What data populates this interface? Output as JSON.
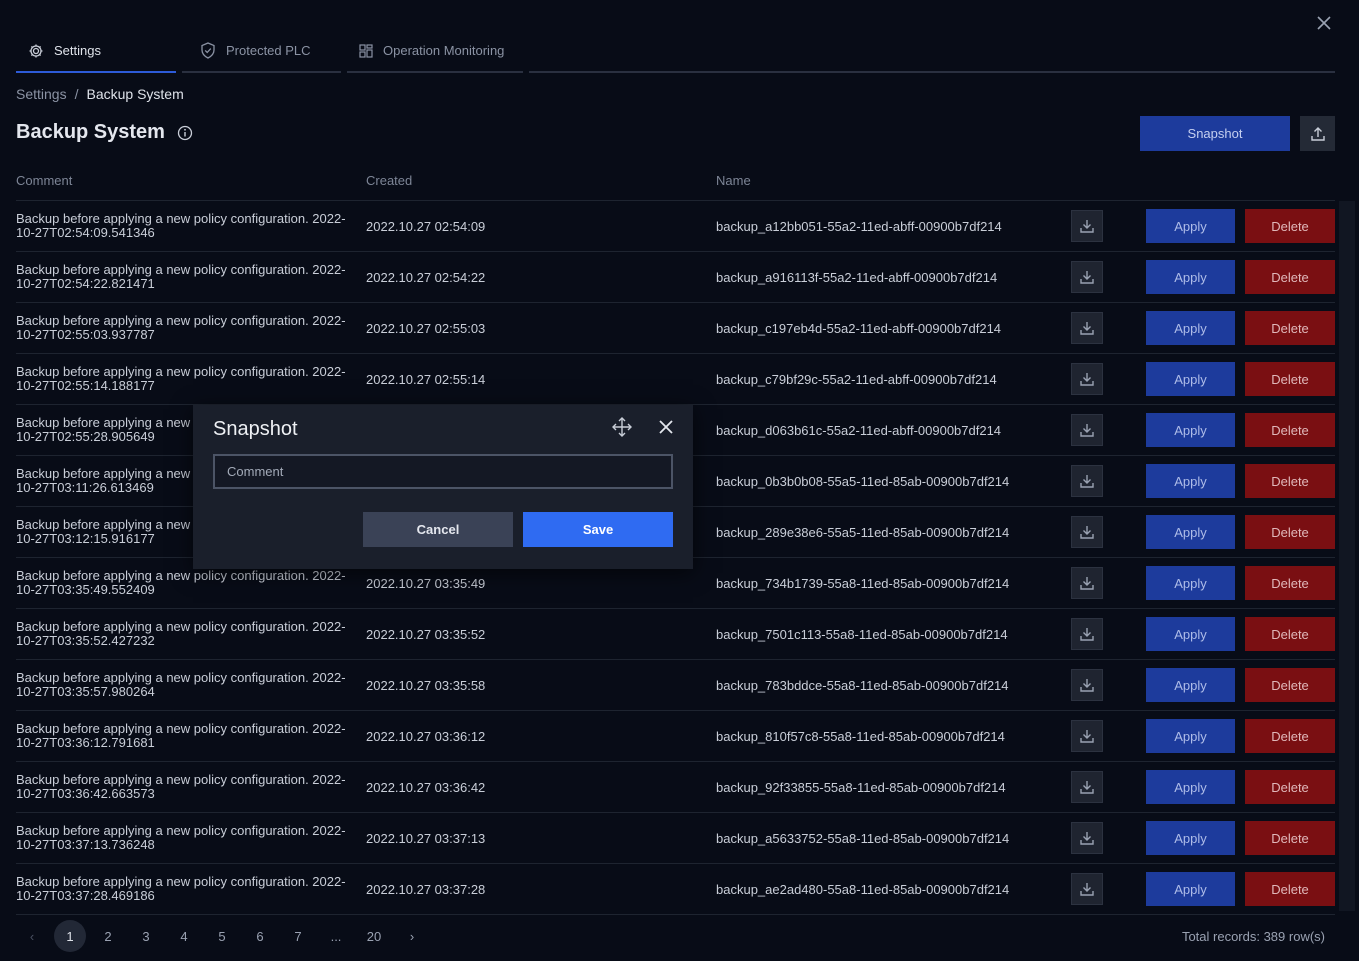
{
  "tabs": [
    {
      "label": "Settings",
      "icon": "gear-icon",
      "active": true
    },
    {
      "label": "Protected PLC",
      "icon": "shield-icon",
      "active": false
    },
    {
      "label": "Operation Monitoring",
      "icon": "grid-icon",
      "active": false
    }
  ],
  "breadcrumb": {
    "root": "Settings",
    "separator": "/",
    "current": "Backup System"
  },
  "page": {
    "title": "Backup System",
    "snapshot_label": "Snapshot"
  },
  "table": {
    "headers": {
      "comment": "Comment",
      "created": "Created",
      "name": "Name"
    },
    "apply_label": "Apply",
    "delete_label": "Delete",
    "rows": [
      {
        "comment": "Backup before applying a new policy configuration. 2022-10-27T02:54:09.541346",
        "created": "2022.10.27 02:54:09",
        "name": "backup_a12bb051-55a2-11ed-abff-00900b7df214"
      },
      {
        "comment": "Backup before applying a new policy configuration. 2022-10-27T02:54:22.821471",
        "created": "2022.10.27 02:54:22",
        "name": "backup_a916113f-55a2-11ed-abff-00900b7df214"
      },
      {
        "comment": "Backup before applying a new policy configuration. 2022-10-27T02:55:03.937787",
        "created": "2022.10.27 02:55:03",
        "name": "backup_c197eb4d-55a2-11ed-abff-00900b7df214"
      },
      {
        "comment": "Backup before applying a new policy configuration. 2022-10-27T02:55:14.188177",
        "created": "2022.10.27 02:55:14",
        "name": "backup_c79bf29c-55a2-11ed-abff-00900b7df214"
      },
      {
        "comment": "Backup before applying a new policy configuration. 2022-10-27T02:55:28.905649",
        "created": "",
        "name": "backup_d063b61c-55a2-11ed-abff-00900b7df214"
      },
      {
        "comment": "Backup before applying a new policy configuration. 2022-10-27T03:11:26.613469",
        "created": "",
        "name": "backup_0b3b0b08-55a5-11ed-85ab-00900b7df214"
      },
      {
        "comment": "Backup before applying a new policy configuration. 2022-10-27T03:12:15.916177",
        "created": "",
        "name": "backup_289e38e6-55a5-11ed-85ab-00900b7df214"
      },
      {
        "comment": "Backup before applying a new policy configuration. 2022-10-27T03:35:49.552409",
        "created": "2022.10.27 03:35:49",
        "name": "backup_734b1739-55a8-11ed-85ab-00900b7df214"
      },
      {
        "comment": "Backup before applying a new policy configuration. 2022-10-27T03:35:52.427232",
        "created": "2022.10.27 03:35:52",
        "name": "backup_7501c113-55a8-11ed-85ab-00900b7df214"
      },
      {
        "comment": "Backup before applying a new policy configuration. 2022-10-27T03:35:57.980264",
        "created": "2022.10.27 03:35:58",
        "name": "backup_783bddce-55a8-11ed-85ab-00900b7df214"
      },
      {
        "comment": "Backup before applying a new policy configuration. 2022-10-27T03:36:12.791681",
        "created": "2022.10.27 03:36:12",
        "name": "backup_810f57c8-55a8-11ed-85ab-00900b7df214"
      },
      {
        "comment": "Backup before applying a new policy configuration. 2022-10-27T03:36:42.663573",
        "created": "2022.10.27 03:36:42",
        "name": "backup_92f33855-55a8-11ed-85ab-00900b7df214"
      },
      {
        "comment": "Backup before applying a new policy configuration. 2022-10-27T03:37:13.736248",
        "created": "2022.10.27 03:37:13",
        "name": "backup_a5633752-55a8-11ed-85ab-00900b7df214"
      },
      {
        "comment": "Backup before applying a new policy configuration. 2022-10-27T03:37:28.469186",
        "created": "2022.10.27 03:37:28",
        "name": "backup_ae2ad480-55a8-11ed-85ab-00900b7df214"
      }
    ]
  },
  "pagination": {
    "prev": "‹",
    "next": "›",
    "pages": [
      "1",
      "2",
      "3",
      "4",
      "5",
      "6",
      "7",
      "...",
      "20"
    ],
    "current": "1",
    "total": "Total records: 389 row(s)"
  },
  "modal": {
    "title": "Snapshot",
    "comment_placeholder": "Comment",
    "comment_value": "",
    "cancel_label": "Cancel",
    "save_label": "Save"
  }
}
